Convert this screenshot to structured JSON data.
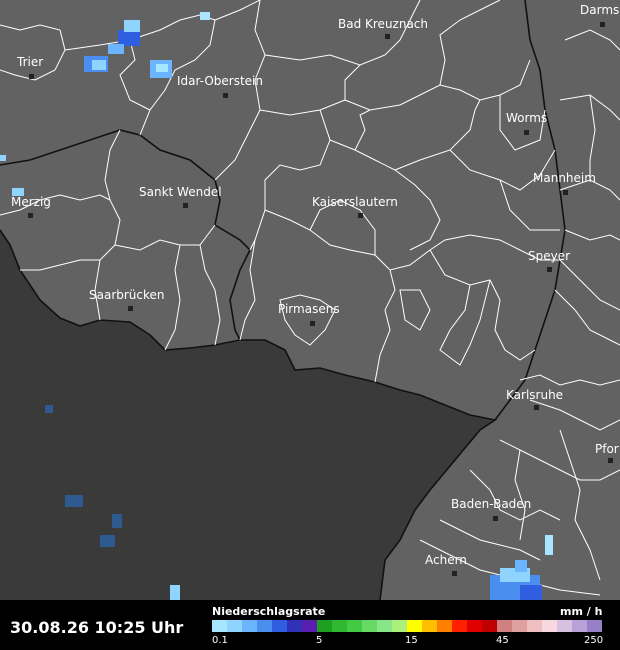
{
  "cities": [
    {
      "name": "Bad Kreuznach"
    },
    {
      "name": "Darms"
    },
    {
      "name": "Trier"
    },
    {
      "name": "Idar-Oberstein"
    },
    {
      "name": "Worms"
    },
    {
      "name": "Merzig"
    },
    {
      "name": "Sankt Wendel"
    },
    {
      "name": "Mannheim"
    },
    {
      "name": "Kaiserslautern"
    },
    {
      "name": "Speyer"
    },
    {
      "name": "Saarbrücken"
    },
    {
      "name": "Pirmasens"
    },
    {
      "name": "Karlsruhe"
    },
    {
      "name": "Pfor"
    },
    {
      "name": "Baden-Baden"
    },
    {
      "name": "Achern"
    }
  ],
  "footer": {
    "timestamp": "30.08.26 10:25 Uhr",
    "legend_title": "Niederschlagsrate",
    "legend_unit": "mm / h",
    "ticks": [
      "0.1",
      "5",
      "15",
      "45",
      "250"
    ]
  },
  "colors": {
    "land": "#626262",
    "outside": "#3a3a3a",
    "borders": "#ffffff",
    "state_border": "#111111",
    "legend": [
      "#a6e6ff",
      "#8fd3ff",
      "#6bb5ff",
      "#4a8ff0",
      "#2f5fe0",
      "#3030b8",
      "#5a1fb0",
      "#1f9f1f",
      "#30b830",
      "#44c944",
      "#66d966",
      "#88e688",
      "#aaf07a",
      "#ffff00",
      "#ffbf00",
      "#ff8000",
      "#ff2000",
      "#e00000",
      "#c00000",
      "#d08080",
      "#e0a0a0",
      "#f0c0c0",
      "#f8d8e0",
      "#d8c0e0",
      "#b8a0d8",
      "#9880c8"
    ]
  }
}
